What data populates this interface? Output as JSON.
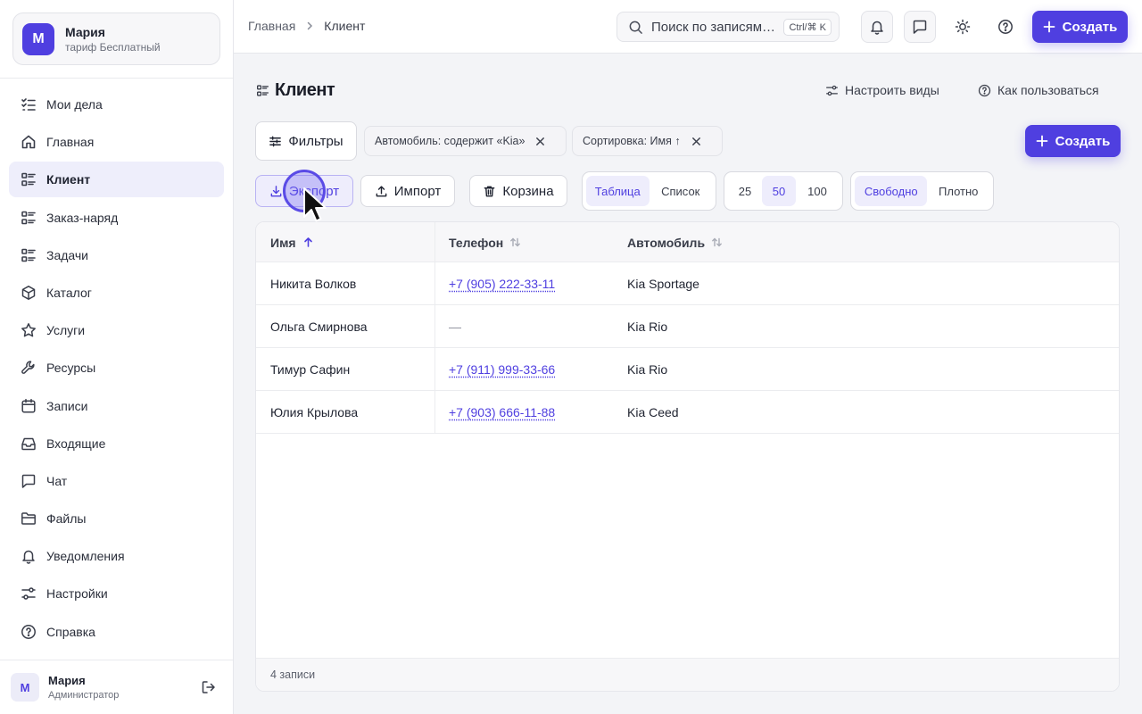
{
  "workspace": {
    "avatar_letter": "М",
    "name": "Мария",
    "plan": "тариф Бесплатный"
  },
  "sidebar": {
    "items": [
      {
        "label": "Мои дела",
        "icon": "checklist-icon"
      },
      {
        "label": "Главная",
        "icon": "home-icon"
      },
      {
        "label": "Клиент",
        "icon": "list-icon",
        "active": true
      },
      {
        "label": "Заказ-наряд",
        "icon": "list-icon"
      },
      {
        "label": "Задачи",
        "icon": "list-icon"
      },
      {
        "label": "Каталог",
        "icon": "box-icon"
      },
      {
        "label": "Услуги",
        "icon": "star-icon"
      },
      {
        "label": "Ресурсы",
        "icon": "wrench-icon"
      },
      {
        "label": "Записи",
        "icon": "calendar-icon"
      },
      {
        "label": "Входящие",
        "icon": "inbox-icon"
      },
      {
        "label": "Чат",
        "icon": "chat-icon"
      },
      {
        "label": "Файлы",
        "icon": "folder-icon"
      },
      {
        "label": "Уведомления",
        "icon": "bell-icon"
      },
      {
        "label": "Настройки",
        "icon": "settings-icon"
      },
      {
        "label": "Справка",
        "icon": "help-icon"
      }
    ]
  },
  "user": {
    "avatar_letter": "М",
    "name": "Мария",
    "role": "Администратор"
  },
  "topbar": {
    "breadcrumb": [
      "Главная",
      "Клиент"
    ],
    "search_placeholder": "Поиск по записям…",
    "search_shortcut": "Ctrl/⌘ K",
    "create_label": "Создать"
  },
  "page": {
    "title": "Клиент",
    "configure_views": "Настроить виды",
    "how_to_use": "Как пользоваться",
    "filters_label": "Фильтры",
    "chips": [
      "Автомобиль: содержит «Kia»",
      "Сортировка: Имя ↑"
    ],
    "create_label": "Создать",
    "export_label": "Экспорт",
    "import_label": "Импорт",
    "trash_label": "Корзина",
    "view_modes": [
      "Таблица",
      "Список"
    ],
    "view_mode_selected": "Таблица",
    "page_sizes": [
      "25",
      "50",
      "100"
    ],
    "page_size_selected": "50",
    "density": [
      "Свободно",
      "Плотно"
    ],
    "density_selected": "Свободно"
  },
  "table": {
    "columns": [
      "Имя",
      "Телефон",
      "Автомобиль"
    ],
    "sorted_column": "Имя",
    "sort_direction": "asc",
    "rows": [
      {
        "name": "Никита Волков",
        "phone": "+7 (905) 222-33-11",
        "car": "Kia Sportage"
      },
      {
        "name": "Ольга Смирнова",
        "phone": "—",
        "car": "Kia Rio"
      },
      {
        "name": "Тимур Сафин",
        "phone": "+7 (911) 999-33-66",
        "car": "Kia Rio"
      },
      {
        "name": "Юлия Крылова",
        "phone": "+7 (903) 666-11-88",
        "car": "Kia Ceed"
      }
    ],
    "footer": "4 записи"
  },
  "colors": {
    "accent": "#4f3fe0",
    "accent_soft": "#eeedfc",
    "background": "#f3f4f7"
  }
}
